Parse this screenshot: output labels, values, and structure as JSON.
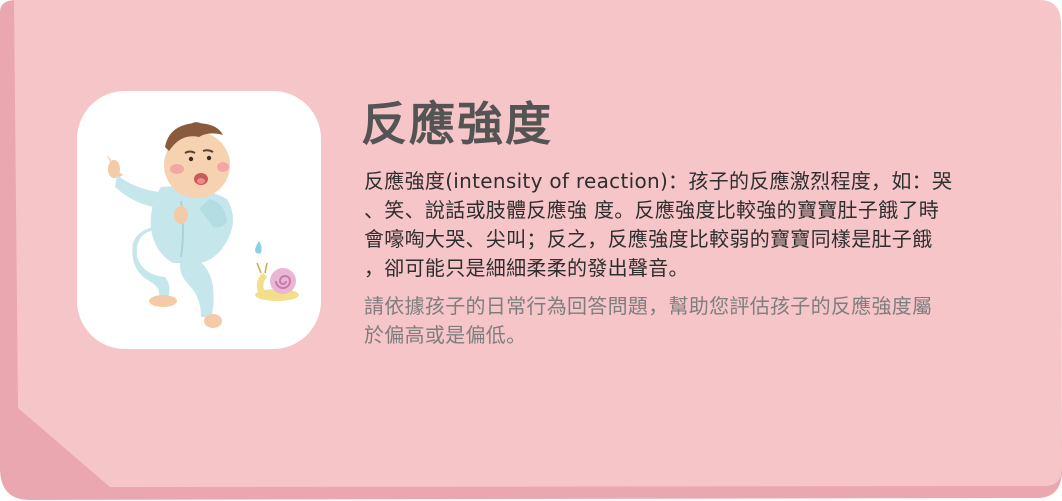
{
  "card": {
    "title": "反應強度",
    "description": "反應強度(intensity of reaction)：孩子的反應激烈程度，如：哭\n、笑、說話或肢體反應強 度。反應強度比較強的寶寶肚子餓了時\n會嚎啕大哭、尖叫；反之，反應強度比較弱的寶寶同樣是肚子餓\n，卻可能只是細細柔柔的發出聲音。",
    "instruction": "請依據孩子的日常行為回答問題，幫助您評估孩子的反應強度屬\n於偏高或是偏低。",
    "illustration_icon": "crying-baby-with-snail-icon"
  },
  "colors": {
    "card_background": "#f6c5c8",
    "card_edge": "#eba7b0",
    "title_text": "#545454",
    "body_text": "#2e2e2e",
    "instruction_text": "#7e7e7e"
  }
}
